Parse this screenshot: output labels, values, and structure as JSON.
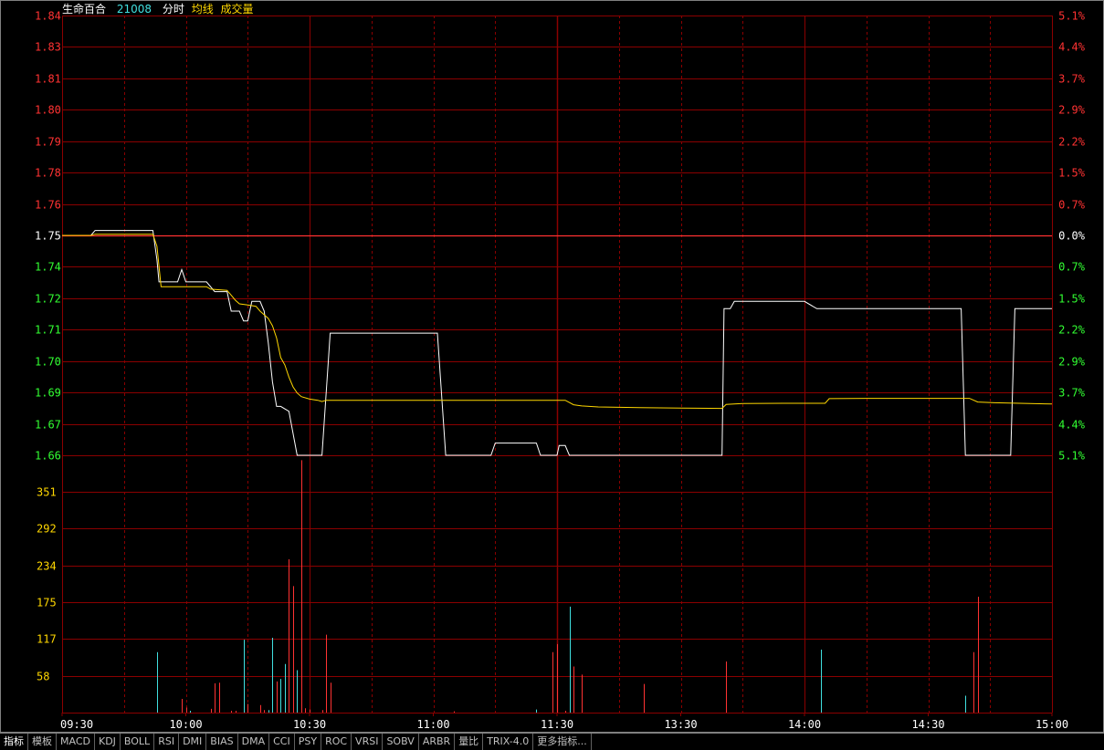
{
  "header": {
    "stock_name": "生命百合",
    "stock_code": "21008",
    "view_label": "分时",
    "avg_label": "均线",
    "volume_label": "成交量"
  },
  "colors": {
    "background": "#000000",
    "grid": "#8b0000",
    "up": "#ff3232",
    "down": "#32ff32",
    "flat": "#ffffff",
    "price_line": "#ffffff",
    "avg_line": "#ffd700",
    "volume_down": "#40e0e0"
  },
  "tabs": [
    "指标",
    "模板",
    "MACD",
    "KDJ",
    "BOLL",
    "RSI",
    "DMI",
    "BIAS",
    "DMA",
    "CCI",
    "PSY",
    "ROC",
    "VRSI",
    "SOBV",
    "ARBR",
    "量比",
    "TRIX-4.0",
    "更多指标..."
  ],
  "chart_data": [
    {
      "type": "line",
      "name": "price",
      "prev_close": 1.75,
      "y_left_ticks": [
        "1.84",
        "1.83",
        "1.81",
        "1.80",
        "1.79",
        "1.78",
        "1.76",
        "1.75",
        "1.74",
        "1.72",
        "1.71",
        "1.70",
        "1.69",
        "1.67",
        "1.66"
      ],
      "y_right_ticks": [
        "5.1%",
        "4.4%",
        "3.7%",
        "2.9%",
        "2.2%",
        "1.5%",
        "0.7%",
        "0.0%",
        "0.7%",
        "1.5%",
        "2.2%",
        "2.9%",
        "3.7%",
        "4.4%",
        "5.1%"
      ],
      "ylim": [
        1.66,
        1.84
      ],
      "x_ticks": [
        "09:30",
        "10:00",
        "10:30",
        "11:00",
        "11:30",
        "13:30",
        "14:00",
        "14:30",
        "15:00"
      ],
      "xlim": [
        0,
        240
      ],
      "series": [
        {
          "name": "分时",
          "points": [
            [
              0,
              1.75
            ],
            [
              7,
              1.75
            ],
            [
              8,
              1.752
            ],
            [
              22,
              1.752
            ],
            [
              23,
              1.74
            ],
            [
              23.5,
              1.731
            ],
            [
              28,
              1.731
            ],
            [
              29,
              1.736
            ],
            [
              30,
              1.731
            ],
            [
              35,
              1.731
            ],
            [
              37,
              1.727
            ],
            [
              40,
              1.727
            ],
            [
              41,
              1.719
            ],
            [
              42,
              1.719
            ],
            [
              43,
              1.719
            ],
            [
              44,
              1.715
            ],
            [
              45,
              1.715
            ],
            [
              46,
              1.723
            ],
            [
              48,
              1.723
            ],
            [
              49,
              1.719
            ],
            [
              50,
              1.706
            ],
            [
              51,
              1.69
            ],
            [
              52,
              1.68
            ],
            [
              53,
              1.68
            ],
            [
              55,
              1.678
            ],
            [
              57,
              1.66
            ],
            [
              60,
              1.66
            ],
            [
              62,
              1.66
            ],
            [
              63,
              1.66
            ],
            [
              65,
              1.71
            ],
            [
              70,
              1.71
            ],
            [
              90,
              1.71
            ],
            [
              91,
              1.71
            ],
            [
              93,
              1.66
            ],
            [
              98,
              1.66
            ],
            [
              104,
              1.66
            ],
            [
              105,
              1.665
            ],
            [
              115,
              1.665
            ],
            [
              116,
              1.66
            ],
            [
              120,
              1.66
            ],
            [
              120.5,
              1.664
            ],
            [
              122,
              1.664
            ],
            [
              123,
              1.66
            ],
            [
              130,
              1.66
            ],
            [
              150,
              1.66
            ],
            [
              157,
              1.66
            ],
            [
              160,
              1.66
            ],
            [
              160.5,
              1.72
            ],
            [
              162,
              1.72
            ],
            [
              163,
              1.723
            ],
            [
              180,
              1.723
            ],
            [
              183,
              1.72
            ],
            [
              200,
              1.72
            ],
            [
              218,
              1.72
            ],
            [
              219,
              1.66
            ],
            [
              224,
              1.66
            ],
            [
              230,
              1.66
            ],
            [
              231,
              1.72
            ],
            [
              240,
              1.72
            ]
          ]
        },
        {
          "name": "均线",
          "points": [
            [
              0,
              1.75
            ],
            [
              7,
              1.75
            ],
            [
              8,
              1.7505
            ],
            [
              22,
              1.7505
            ],
            [
              23,
              1.7455
            ],
            [
              24,
              1.729
            ],
            [
              30,
              1.729
            ],
            [
              35,
              1.729
            ],
            [
              36,
              1.728
            ],
            [
              40,
              1.7275
            ],
            [
              41,
              1.7255
            ],
            [
              42,
              1.7235
            ],
            [
              43,
              1.722
            ],
            [
              45,
              1.7215
            ],
            [
              47,
              1.721
            ],
            [
              48,
              1.719
            ],
            [
              50,
              1.716
            ],
            [
              51,
              1.713
            ],
            [
              52,
              1.708
            ],
            [
              53,
              1.7
            ],
            [
              54,
              1.697
            ],
            [
              55,
              1.692
            ],
            [
              56,
              1.688
            ],
            [
              57,
              1.6855
            ],
            [
              58,
              1.684
            ],
            [
              60,
              1.683
            ],
            [
              62,
              1.6825
            ],
            [
              63,
              1.682
            ],
            [
              64,
              1.6825
            ],
            [
              70,
              1.6825
            ],
            [
              90,
              1.6825
            ],
            [
              100,
              1.6825
            ],
            [
              110,
              1.6825
            ],
            [
              120,
              1.6825
            ],
            [
              122,
              1.6825
            ],
            [
              124,
              1.6807
            ],
            [
              126,
              1.6802
            ],
            [
              130,
              1.6798
            ],
            [
              140,
              1.6795
            ],
            [
              150,
              1.6793
            ],
            [
              160,
              1.6792
            ],
            [
              161,
              1.6808
            ],
            [
              165,
              1.6812
            ],
            [
              175,
              1.6813
            ],
            [
              185,
              1.6813
            ],
            [
              186,
              1.6832
            ],
            [
              195,
              1.6833
            ],
            [
              210,
              1.6833
            ],
            [
              220,
              1.6833
            ],
            [
              222,
              1.6818
            ],
            [
              226,
              1.6815
            ],
            [
              240,
              1.681
            ]
          ]
        }
      ]
    },
    {
      "type": "bar",
      "name": "volume",
      "y_ticks": [
        "351",
        "292",
        "234",
        "175",
        "117",
        "58"
      ],
      "ylim": [
        0,
        410
      ],
      "xlim": [
        0,
        240
      ],
      "bars": [
        {
          "t": 23,
          "v": 97,
          "dir": "down"
        },
        {
          "t": 29,
          "v": 22,
          "dir": "up"
        },
        {
          "t": 30,
          "v": 8,
          "dir": "up"
        },
        {
          "t": 31,
          "v": 3,
          "dir": "down"
        },
        {
          "t": 36,
          "v": 6,
          "dir": "up"
        },
        {
          "t": 37,
          "v": 47,
          "dir": "up"
        },
        {
          "t": 38,
          "v": 48,
          "dir": "up"
        },
        {
          "t": 41,
          "v": 3,
          "dir": "up"
        },
        {
          "t": 42,
          "v": 3,
          "dir": "up"
        },
        {
          "t": 44,
          "v": 117,
          "dir": "down"
        },
        {
          "t": 45,
          "v": 14,
          "dir": "up"
        },
        {
          "t": 48,
          "v": 12,
          "dir": "up"
        },
        {
          "t": 49,
          "v": 4,
          "dir": "up"
        },
        {
          "t": 50,
          "v": 4,
          "dir": "down"
        },
        {
          "t": 51,
          "v": 120,
          "dir": "down"
        },
        {
          "t": 52,
          "v": 50,
          "dir": "up"
        },
        {
          "t": 53,
          "v": 54,
          "dir": "down"
        },
        {
          "t": 54,
          "v": 78,
          "dir": "down"
        },
        {
          "t": 55,
          "v": 246,
          "dir": "up"
        },
        {
          "t": 56,
          "v": 203,
          "dir": "up"
        },
        {
          "t": 57,
          "v": 68,
          "dir": "down"
        },
        {
          "t": 58,
          "v": 405,
          "dir": "up"
        },
        {
          "t": 59,
          "v": 7,
          "dir": "up"
        },
        {
          "t": 60,
          "v": 5,
          "dir": "up"
        },
        {
          "t": 63,
          "v": 4,
          "dir": "up"
        },
        {
          "t": 64,
          "v": 125,
          "dir": "up"
        },
        {
          "t": 65,
          "v": 48,
          "dir": "up"
        },
        {
          "t": 95,
          "v": 2,
          "dir": "up"
        },
        {
          "t": 115,
          "v": 5,
          "dir": "down"
        },
        {
          "t": 119,
          "v": 97,
          "dir": "up"
        },
        {
          "t": 120,
          "v": 110,
          "dir": "up"
        },
        {
          "t": 122,
          "v": 3,
          "dir": "up"
        },
        {
          "t": 123,
          "v": 170,
          "dir": "down"
        },
        {
          "t": 124,
          "v": 74,
          "dir": "up"
        },
        {
          "t": 126,
          "v": 61,
          "dir": "up"
        },
        {
          "t": 141,
          "v": 46,
          "dir": "up"
        },
        {
          "t": 161,
          "v": 82,
          "dir": "up"
        },
        {
          "t": 184,
          "v": 101,
          "dir": "down"
        },
        {
          "t": 219,
          "v": 27,
          "dir": "down"
        },
        {
          "t": 221,
          "v": 97,
          "dir": "up"
        },
        {
          "t": 222,
          "v": 186,
          "dir": "up"
        }
      ]
    }
  ]
}
